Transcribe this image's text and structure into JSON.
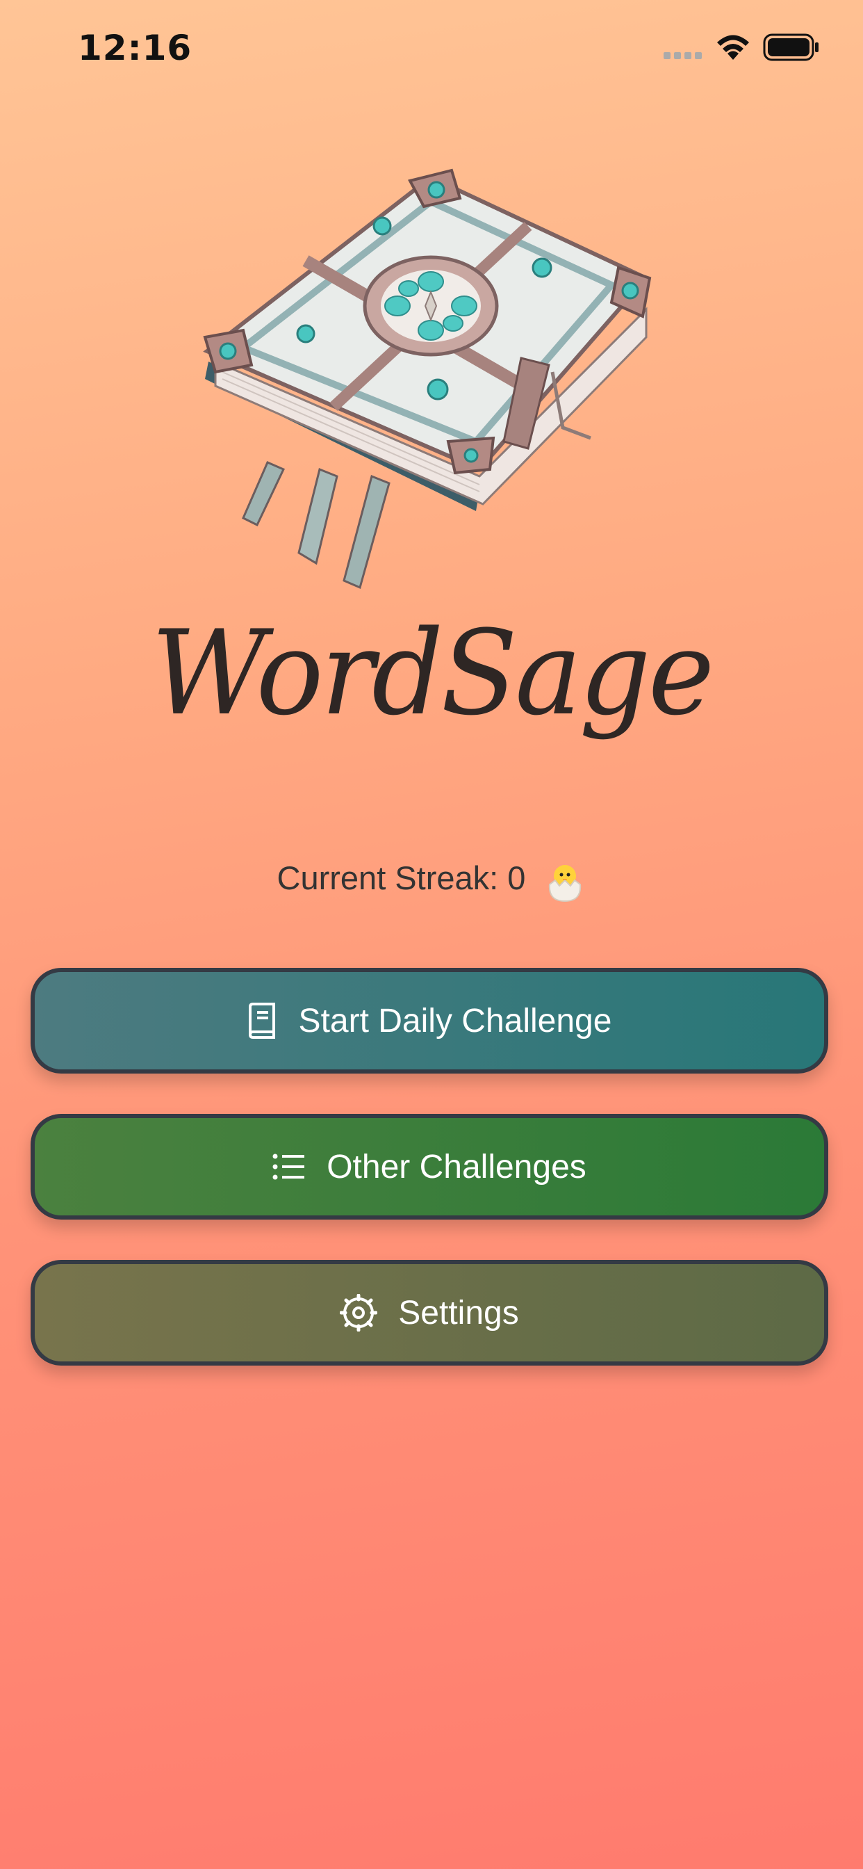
{
  "status_bar": {
    "time": "12:16"
  },
  "app": {
    "title": "WordSage"
  },
  "streak": {
    "label": "Current Streak: 0"
  },
  "buttons": {
    "daily": {
      "label": "Start Daily Challenge",
      "icon": "book-icon",
      "color": "#287778"
    },
    "other": {
      "label": "Other Challenges",
      "icon": "list-icon",
      "color": "#2b7a37"
    },
    "settings": {
      "label": "Settings",
      "icon": "gear-icon",
      "color": "#5d6a46"
    }
  },
  "colors": {
    "background_top": "#ffc596",
    "background_bottom": "#ff7b6e",
    "button_border": "#343a44"
  }
}
